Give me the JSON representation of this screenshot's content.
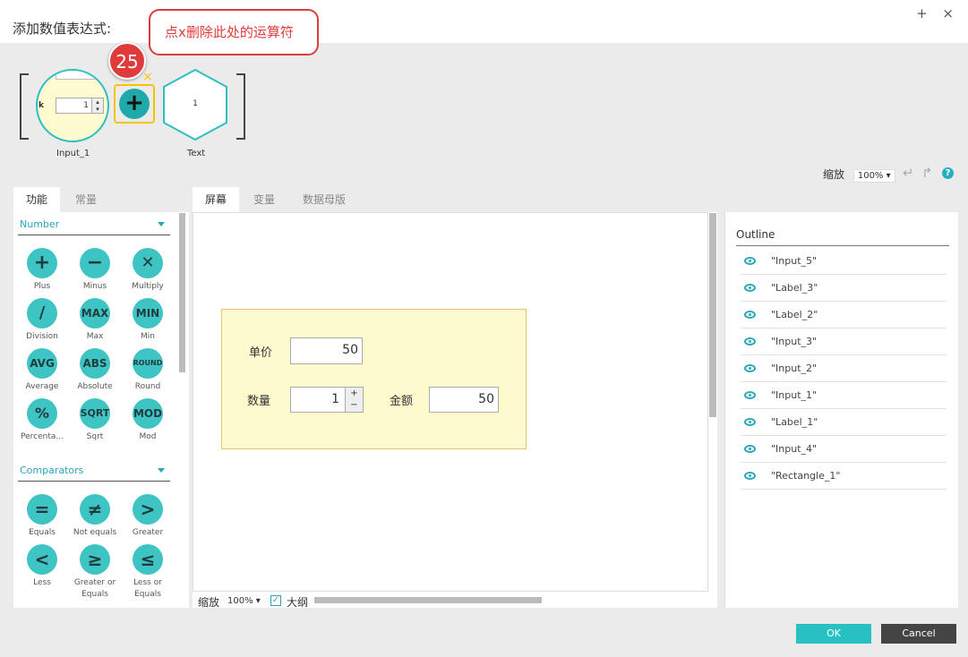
{
  "window": {
    "title": "添加数值表达式:",
    "controls": [
      "+",
      "×"
    ]
  },
  "annotation": {
    "badge": "25",
    "callout": "点x删除此处的运算符"
  },
  "expression": {
    "input_node": {
      "label": "Input_1",
      "value": "1",
      "prefix": "k"
    },
    "operator": {
      "symbol": "+",
      "remove": "×"
    },
    "text_node": {
      "label": "Text",
      "value": "1"
    }
  },
  "toolbar": {
    "zoom_label": "缩放",
    "zoom_value": "100%"
  },
  "left_panel": {
    "tabs": [
      "功能",
      "常量"
    ],
    "sections": [
      {
        "title": "Number",
        "items": [
          {
            "icon": "+",
            "label": "Plus"
          },
          {
            "icon": "−",
            "label": "Minus"
          },
          {
            "icon": "✕",
            "label": "Multiply"
          },
          {
            "icon": "/",
            "label": "Division"
          },
          {
            "icon": "MAX",
            "label": "Max"
          },
          {
            "icon": "MIN",
            "label": "Min"
          },
          {
            "icon": "AVG",
            "label": "Average"
          },
          {
            "icon": "ABS",
            "label": "Absolute"
          },
          {
            "icon": "ROUND",
            "label": "Round"
          },
          {
            "icon": "%",
            "label": "Percenta..."
          },
          {
            "icon": "SQRT",
            "label": "Sqrt"
          },
          {
            "icon": "MOD",
            "label": "Mod"
          }
        ]
      },
      {
        "title": "Comparators",
        "items": [
          {
            "icon": "=",
            "label": "Equals"
          },
          {
            "icon": "≠",
            "label": "Not equals"
          },
          {
            "icon": ">",
            "label": "Greater"
          },
          {
            "icon": "<",
            "label": "Less"
          },
          {
            "icon": "≥",
            "label": "Greater or Equals"
          },
          {
            "icon": "≤",
            "label": "Less or Equals"
          }
        ]
      }
    ]
  },
  "center": {
    "tabs": [
      "屏幕",
      "变量",
      "数据母版"
    ],
    "form": {
      "price_label": "单价",
      "price_value": "50",
      "qty_label": "数量",
      "qty_value": "1",
      "amount_label": "金额",
      "amount_value": "50"
    },
    "bottom": {
      "zoom_label": "缩放",
      "zoom_value": "100%",
      "outline_label": "大纲"
    }
  },
  "outline": {
    "title": "Outline",
    "items": [
      "\"Input_5\"",
      "\"Label_3\"",
      "\"Label_2\"",
      "\"Input_3\"",
      "\"Input_2\"",
      "\"Input_1\"",
      "\"Label_1\"",
      "\"Input_4\"",
      "\"Rectangle_1\""
    ]
  },
  "buttons": {
    "ok": "OK",
    "cancel": "Cancel"
  }
}
